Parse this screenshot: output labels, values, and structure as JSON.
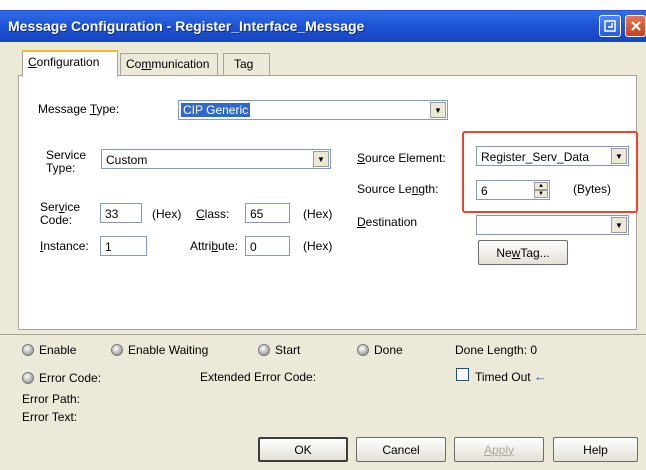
{
  "window": {
    "title": "Message Configuration - Register_Interface_Message",
    "help_icon": "restore-icon",
    "close_icon": "close-icon"
  },
  "tabs": [
    {
      "label_pre": "C",
      "label_rest": "onfiguration"
    },
    {
      "label_pre": "Co",
      "label_u": "m",
      "label_rest": "munication"
    },
    {
      "label": "Tag"
    }
  ],
  "config": {
    "message_type_label_pre": "Message ",
    "message_type_label_u": "T",
    "message_type_label_post": "ype:",
    "message_type_value": "CIP Generic",
    "service_type_label_line1": "Service",
    "service_type_label_line2": "Type:",
    "service_type_value": "Custom",
    "service_code_label_line1": "Ser",
    "service_code_label_u": "v",
    "service_code_label_rest": "ice",
    "service_code_label_line2": "Code:",
    "service_code_value": "33",
    "service_code_unit": "(Hex)",
    "class_label_u": "C",
    "class_label_rest": "lass:",
    "class_value": "65",
    "class_unit": "(Hex)",
    "instance_label_u": "I",
    "instance_label_rest": "nstance:",
    "instance_value": "1",
    "attribute_label_pre": "Attri",
    "attribute_label_u": "b",
    "attribute_label_rest": "ute:",
    "attribute_value": "0",
    "attribute_unit": "(Hex)",
    "source_element_label_u": "S",
    "source_element_label_rest": "ource Element:",
    "source_element_value": "Register_Serv_Data",
    "source_length_label_pre": "Source Le",
    "source_length_label_u": "n",
    "source_length_label_rest": "gth:",
    "source_length_value": "6",
    "source_length_unit": "(Bytes)",
    "destination_label_u": "D",
    "destination_label_rest": "estination",
    "destination_value": "",
    "new_tag_label_pre": "Ne",
    "new_tag_label_u": "w",
    "new_tag_label_rest": " Tag..."
  },
  "status": {
    "enable": "Enable",
    "enable_waiting": "Enable Waiting",
    "start": "Start",
    "done": "Done",
    "done_length": "Done Length: 0",
    "error_code": "Error Code:",
    "extended_error_code": "Extended Error Code:",
    "timed_out": "Timed Out",
    "timed_out_arrow": "←",
    "error_path": "Error Path:",
    "error_text": "Error Text:"
  },
  "buttons": {
    "ok": "OK",
    "cancel": "Cancel",
    "apply": "Apply",
    "help": "Help"
  }
}
